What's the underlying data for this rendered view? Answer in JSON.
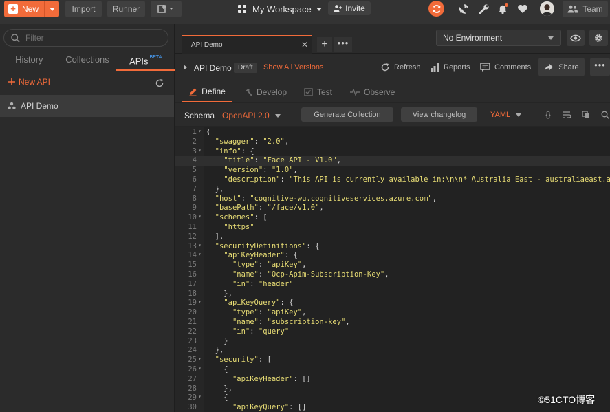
{
  "header": {
    "new_label": "New",
    "import_label": "Import",
    "runner_label": "Runner",
    "workspace_label": "My Workspace",
    "invite_label": "Invite",
    "team_label": "Team"
  },
  "sidebar": {
    "filter_placeholder": "Filter",
    "tabs": [
      {
        "label": "History"
      },
      {
        "label": "Collections"
      },
      {
        "label": "APIs",
        "badge": "BETA"
      }
    ],
    "new_api_label": "New API",
    "items": [
      {
        "label": "API Demo"
      }
    ]
  },
  "tabs": {
    "active_tab_label": "API Demo"
  },
  "environment": {
    "selected": "No Environment"
  },
  "api_bar": {
    "title": "API Demo",
    "status_badge": "Draft",
    "show_versions_label": "Show All Versions",
    "refresh_label": "Refresh",
    "reports_label": "Reports",
    "comments_label": "Comments",
    "share_label": "Share"
  },
  "subtabs": [
    {
      "label": "Define"
    },
    {
      "label": "Develop"
    },
    {
      "label": "Test"
    },
    {
      "label": "Observe"
    }
  ],
  "schema_bar": {
    "schema_label": "Schema",
    "format": "OpenAPI 2.0",
    "generate_label": "Generate Collection",
    "changelog_label": "View changelog",
    "language": "YAML"
  },
  "editor": {
    "lines": [
      "{",
      "  \"swagger\": \"2.0\",",
      "  \"info\": {",
      "    \"title\": \"Face API - V1.0\",",
      "    \"version\": \"1.0\",",
      "    \"description\": \"This API is currently available in:\\n\\n* Australia East - australiaeast.ap",
      "  },",
      "  \"host\": \"cognitive-wu.cognitiveservices.azure.com\",",
      "  \"basePath\": \"/face/v1.0\",",
      "  \"schemes\": [",
      "    \"https\"",
      "  ],",
      "  \"securityDefinitions\": {",
      "    \"apiKeyHeader\": {",
      "      \"type\": \"apiKey\",",
      "      \"name\": \"Ocp-Apim-Subscription-Key\",",
      "      \"in\": \"header\"",
      "    },",
      "    \"apiKeyQuery\": {",
      "      \"type\": \"apiKey\",",
      "      \"name\": \"subscription-key\",",
      "      \"in\": \"query\"",
      "    }",
      "  },",
      "  \"security\": [",
      "    {",
      "      \"apiKeyHeader\": []",
      "    },",
      "    {",
      "      \"apiKeyQuery\": []"
    ],
    "foldable_lines": [
      1,
      3,
      10,
      13,
      14,
      19,
      25,
      26,
      29
    ],
    "current_line": 4
  },
  "watermark": "©51CTO博客"
}
